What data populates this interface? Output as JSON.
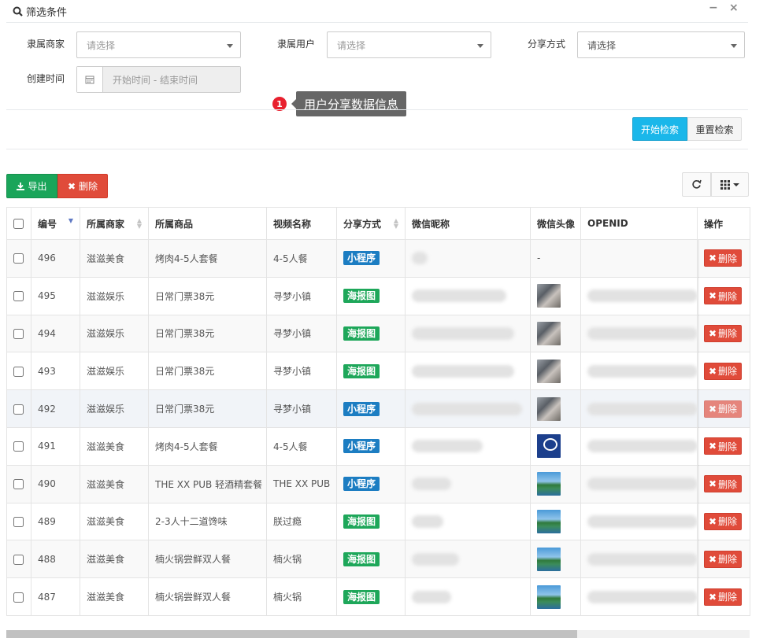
{
  "filter": {
    "title": "筛选条件",
    "minimize_icon": "−",
    "close_icon": "×",
    "fields": {
      "merchant": {
        "label": "隶属商家",
        "value": "请选择"
      },
      "user": {
        "label": "隶属用户",
        "value": "请选择"
      },
      "share_type": {
        "label": "分享方式",
        "value": "请选择"
      },
      "created": {
        "label": "创建时间",
        "placeholder": "开始时间 - 结束时间"
      }
    },
    "search_button": "开始检索",
    "reset_button": "重置检索"
  },
  "tour": {
    "step": "1",
    "text": "用户分享数据信息"
  },
  "toolbar": {
    "export_label": "导出",
    "delete_label": "删除"
  },
  "table": {
    "headers": {
      "id": "编号",
      "merchant": "所属商家",
      "product": "所属商品",
      "video": "视频名称",
      "share_type": "分享方式",
      "nickname": "微信昵称",
      "avatar": "微信头像",
      "openid": "OPENID",
      "action": "操作"
    },
    "delete_label": "删除",
    "rows": [
      {
        "id": "496",
        "merchant": "滋滋美食",
        "product": "烤肉4-5人套餐",
        "video": "4-5人餐",
        "share_type": "小程序",
        "share_kind": "mini",
        "avatar": "-",
        "avatar_kind": "none"
      },
      {
        "id": "495",
        "merchant": "滋滋娱乐",
        "product": "日常门票38元",
        "video": "寻梦小镇",
        "share_type": "海报图",
        "share_kind": "poster",
        "avatar": "",
        "avatar_kind": "bike"
      },
      {
        "id": "494",
        "merchant": "滋滋娱乐",
        "product": "日常门票38元",
        "video": "寻梦小镇",
        "share_type": "海报图",
        "share_kind": "poster",
        "avatar": "",
        "avatar_kind": "bike"
      },
      {
        "id": "493",
        "merchant": "滋滋娱乐",
        "product": "日常门票38元",
        "video": "寻梦小镇",
        "share_type": "海报图",
        "share_kind": "poster",
        "avatar": "",
        "avatar_kind": "bike"
      },
      {
        "id": "492",
        "merchant": "滋滋娱乐",
        "product": "日常门票38元",
        "video": "寻梦小镇",
        "share_type": "小程序",
        "share_kind": "mini",
        "avatar": "",
        "avatar_kind": "bike"
      },
      {
        "id": "491",
        "merchant": "滋滋美食",
        "product": "烤肉4-5人套餐",
        "video": "4-5人餐",
        "share_type": "小程序",
        "share_kind": "mini",
        "avatar": "",
        "avatar_kind": "logo"
      },
      {
        "id": "490",
        "merchant": "滋滋美食",
        "product": "THE XX PUB 轻酒精套餐",
        "video": "THE XX PUB",
        "share_type": "小程序",
        "share_kind": "mini",
        "avatar": "",
        "avatar_kind": "lake"
      },
      {
        "id": "489",
        "merchant": "滋滋美食",
        "product": "2-3人十二道馋味",
        "video": "朕过瘾",
        "share_type": "海报图",
        "share_kind": "poster",
        "avatar": "",
        "avatar_kind": "lake"
      },
      {
        "id": "488",
        "merchant": "滋滋美食",
        "product": "楠火锅尝鲜双人餐",
        "video": "楠火锅",
        "share_type": "海报图",
        "share_kind": "poster",
        "avatar": "",
        "avatar_kind": "lake"
      },
      {
        "id": "487",
        "merchant": "滋滋美食",
        "product": "楠火锅尝鲜双人餐",
        "video": "楠火锅",
        "share_type": "海报图",
        "share_kind": "poster",
        "avatar": "",
        "avatar_kind": "lake"
      }
    ]
  },
  "colors": {
    "mini": "#1c7dc2",
    "poster": "#1ea75a",
    "danger": "#e04b3a",
    "primary": "#1ab7ea",
    "success": "#1aa55a"
  }
}
